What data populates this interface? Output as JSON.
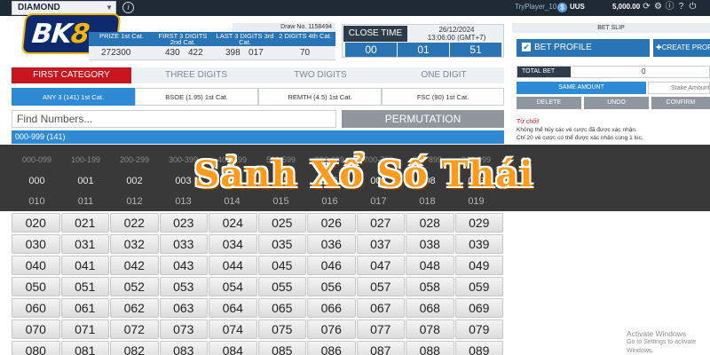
{
  "topbar": {
    "level": "DIAMOND",
    "player": "TryPlayer_10",
    "currency": "UUS",
    "balance": "5,000.00",
    "icons": [
      "refresh-icon",
      "settings-icon",
      "info-icon",
      "question-icon",
      "logout-icon"
    ]
  },
  "logo": {
    "text_a": "BK",
    "text_b": "8"
  },
  "draw": {
    "number": "Draw No. 1158494",
    "headers": [
      "PRIZE 1st Cat.",
      "FIRST 3 DIGITS 2nd Cat.",
      "LAST 3 DIGITS 3rd Cat.",
      "2 DIGITS 4th Cat."
    ],
    "values": [
      "272300",
      "430",
      "422",
      "398",
      "017",
      "70"
    ]
  },
  "close_time": {
    "label": "CLOSE TIME",
    "date": "26/12/2024",
    "time": "13:06:00 (GMT+7)",
    "countdown": [
      "00",
      "01",
      "51"
    ]
  },
  "category_tabs": [
    "FIRST CATEGORY",
    "THREE DIGITS",
    "TWO DIGITS",
    "ONE DIGIT"
  ],
  "sub_tabs": [
    "ANY 3 (141) 1st Cat.",
    "BSOE (1.95) 1st Cat.",
    "REMTH (4.5) 1st Cat.",
    "FSC (90) 1st Cat."
  ],
  "find": {
    "placeholder": "Find Numbers...",
    "permutation": "PERMUTATION"
  },
  "range_label": "000-999 (141)",
  "range_tabs": [
    "000-099",
    "100-199",
    "200-299",
    "300-399",
    "400-499",
    "500-599",
    "600-699",
    "700-799",
    "800-899",
    "900-999"
  ],
  "grid_rows": [
    [
      "000",
      "001",
      "002",
      "003",
      "004",
      "005",
      "006",
      "007",
      "008",
      "009"
    ],
    [
      "010",
      "011",
      "012",
      "013",
      "014",
      "015",
      "016",
      "017",
      "018",
      "019"
    ],
    [
      "020",
      "021",
      "022",
      "023",
      "024",
      "025",
      "026",
      "027",
      "028",
      "029"
    ],
    [
      "030",
      "031",
      "032",
      "033",
      "034",
      "035",
      "036",
      "037",
      "038",
      "039"
    ],
    [
      "040",
      "041",
      "042",
      "043",
      "044",
      "045",
      "046",
      "047",
      "048",
      "049"
    ],
    [
      "050",
      "051",
      "052",
      "053",
      "054",
      "055",
      "056",
      "057",
      "058",
      "059"
    ],
    [
      "060",
      "061",
      "062",
      "063",
      "064",
      "065",
      "066",
      "067",
      "068",
      "069"
    ],
    [
      "070",
      "071",
      "072",
      "073",
      "074",
      "075",
      "076",
      "077",
      "078",
      "079"
    ],
    [
      "080",
      "081",
      "082",
      "083",
      "084",
      "085",
      "086",
      "087",
      "088",
      "089"
    ]
  ],
  "headline": "Sảnh Xổ Số Thái",
  "bet_slip": {
    "title": "BET SLIP",
    "bet_profile": "BET PROFILE",
    "create_profile": "CREATE PROFILE",
    "total_bet_label": "TOTAL BET",
    "total_bet_value": "0",
    "same_amount": "SAME AMOUNT",
    "stake_placeholder": "Stake Amount",
    "delete": "DELETE",
    "undo": "UNDO",
    "confirm": "CONFIRM",
    "reject_title": "Từ chối!",
    "reject_lines": [
      "Không thể hủy các vé cược đã được xác nhận.",
      "Chỉ 20 vé cược có thể được xác nhận cùng 1 lúc."
    ]
  },
  "watermark": {
    "line1": "Activate Windows",
    "line2": "Go to Settings to activate Windows."
  },
  "colors": {
    "accent_red": "#c8161f",
    "accent_blue": "#2f8ad6",
    "headline_orange": "#ff9a1a",
    "logo_gold": "#f5b500"
  }
}
